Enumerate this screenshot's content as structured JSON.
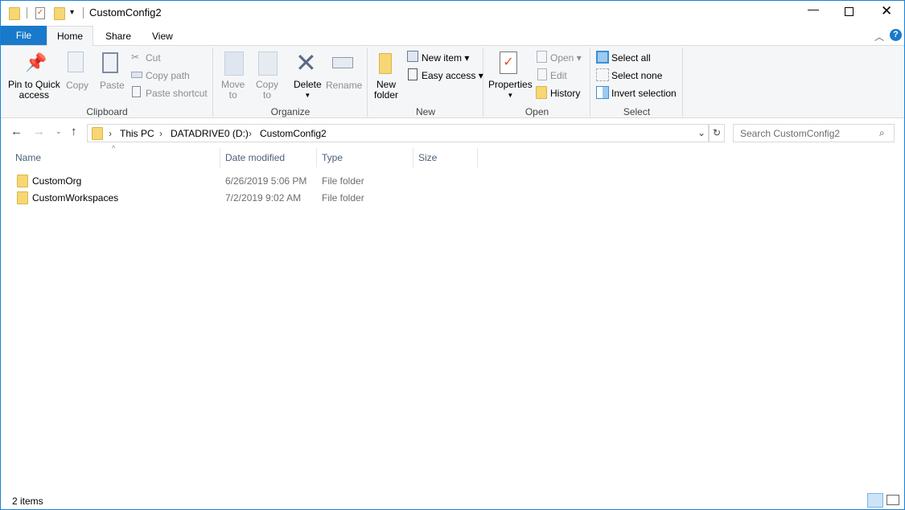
{
  "title": "CustomConfig2",
  "tabs": {
    "file": "File",
    "home": "Home",
    "share": "Share",
    "view": "View"
  },
  "clipboard": {
    "pin": "Pin to Quick",
    "pin2": "access",
    "copy": "Copy",
    "paste": "Paste",
    "cut": "Cut",
    "copy_path": "Copy path",
    "paste_shortcut": "Paste shortcut",
    "label": "Clipboard"
  },
  "organize": {
    "move": "Move",
    "move2": "to",
    "copy": "Copy",
    "copy2": "to",
    "delete": "Delete",
    "rename": "Rename",
    "label": "Organize"
  },
  "new": {
    "folder": "New",
    "folder2": "folder",
    "item": "New item",
    "easy": "Easy access",
    "label": "New"
  },
  "open": {
    "properties": "Properties",
    "open": "Open",
    "edit": "Edit",
    "history": "History",
    "label": "Open"
  },
  "select": {
    "all": "Select all",
    "none": "Select none",
    "invert": "Invert selection",
    "label": "Select"
  },
  "path": [
    "This PC",
    "DATADRIVE0 (D:)",
    "CustomConfig2"
  ],
  "search_placeholder": "Search CustomConfig2",
  "columns": {
    "name": "Name",
    "date": "Date modified",
    "type": "Type",
    "size": "Size"
  },
  "files": [
    {
      "name": "CustomOrg",
      "date": "6/26/2019 5:06 PM",
      "type": "File folder"
    },
    {
      "name": "CustomWorkspaces",
      "date": "7/2/2019 9:02 AM",
      "type": "File folder"
    }
  ],
  "status": "2 items"
}
